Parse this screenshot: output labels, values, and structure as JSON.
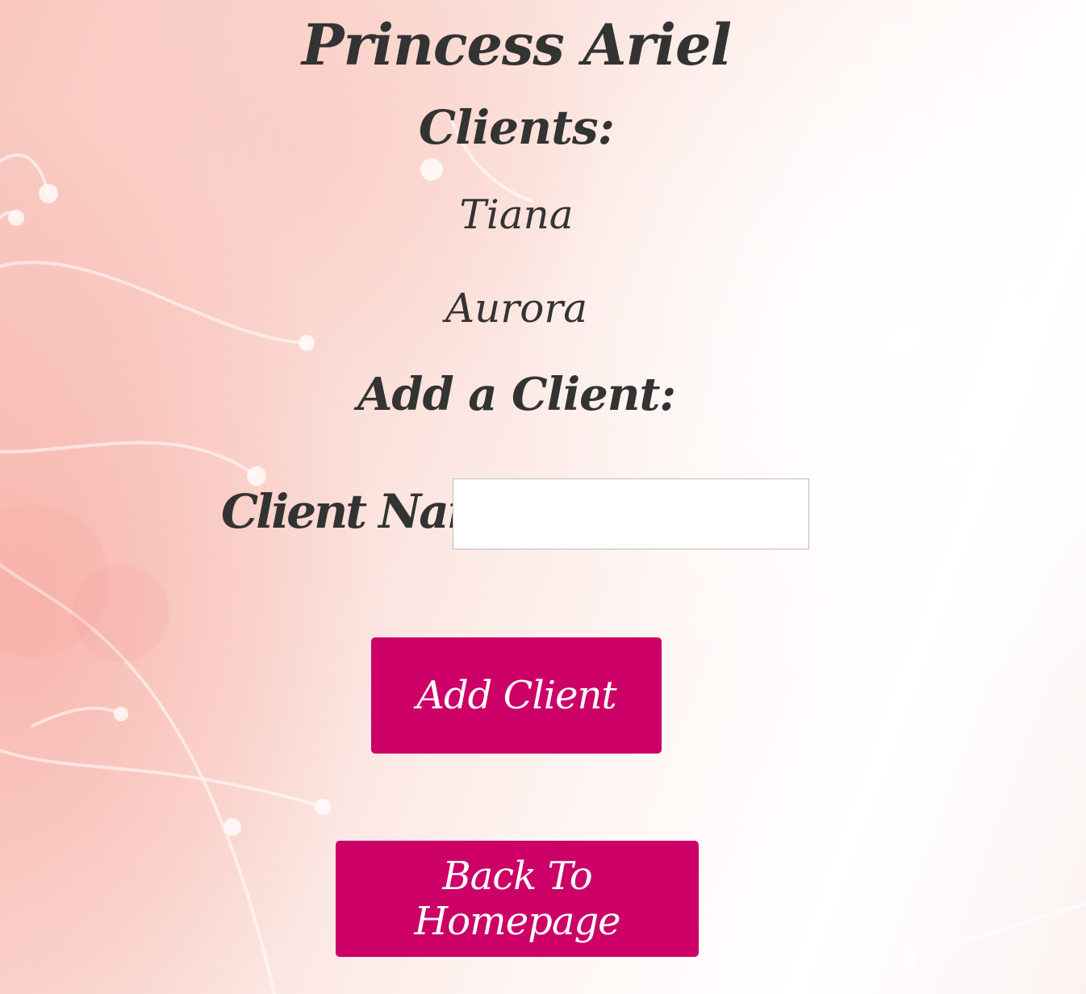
{
  "page": {
    "title": "Princess Ariel"
  },
  "clients": {
    "heading": "Clients:",
    "items": [
      {
        "name": "Tiana"
      },
      {
        "name": "Aurora"
      }
    ]
  },
  "add_client_form": {
    "heading": "Add a Client:",
    "name_label": "Client Name",
    "name_value": "",
    "name_placeholder": "",
    "submit_label": "Add Client"
  },
  "navigation": {
    "back_label": "Back To Homepage"
  },
  "colors": {
    "button_background": "#cc0066",
    "button_text": "#ffffff",
    "heading_text": "#333333"
  }
}
